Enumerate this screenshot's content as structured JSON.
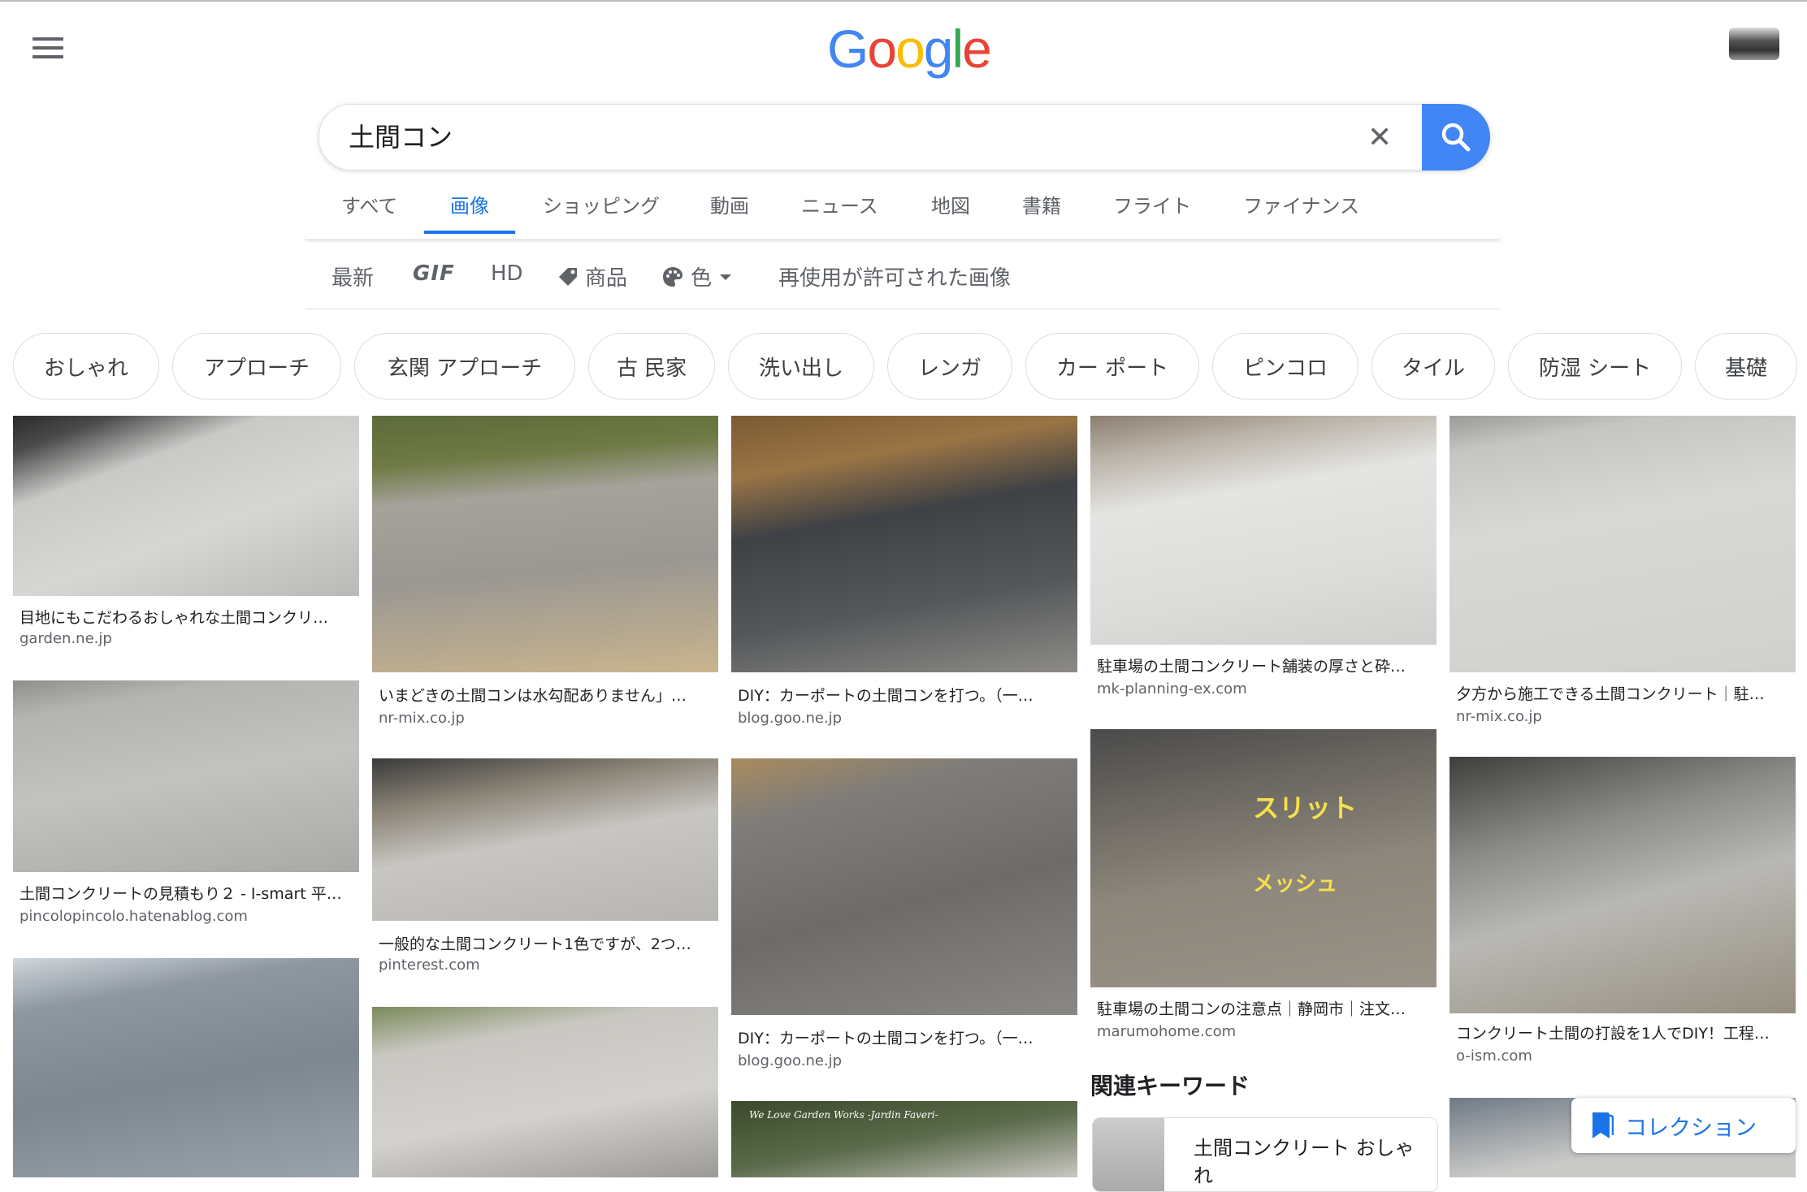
{
  "logo": [
    "G",
    "o",
    "o",
    "g",
    "l",
    "e"
  ],
  "search": {
    "value": "土間コン"
  },
  "tabs": [
    {
      "label": "すべて",
      "active": false
    },
    {
      "label": "画像",
      "active": true
    },
    {
      "label": "ショッピング",
      "active": false
    },
    {
      "label": "動画",
      "active": false
    },
    {
      "label": "ニュース",
      "active": false
    },
    {
      "label": "地図",
      "active": false
    },
    {
      "label": "書籍",
      "active": false
    },
    {
      "label": "フライト",
      "active": false
    },
    {
      "label": "ファイナンス",
      "active": false
    }
  ],
  "filters": {
    "latest": "最新",
    "gif": "GIF",
    "hd": "HD",
    "product": "商品",
    "color": "色",
    "reuse": "再使用が許可された画像"
  },
  "chips": [
    "おしゃれ",
    "アプローチ",
    "玄関 アプローチ",
    "古 民家",
    "洗い出し",
    "レンガ",
    "カー ポート",
    "ピンコロ",
    "タイル",
    "防湿 シート",
    "基礎"
  ],
  "results": [
    {
      "title": "目地にもこだわるおしゃれな土間コンクリ…",
      "site": "garden.ne.jp"
    },
    {
      "title": "土間コンクリートの見積もり２ - I-smart 平…",
      "site": "pincolopincolo.hatenablog.com"
    },
    {
      "title": "",
      "site": ""
    },
    {
      "title": "いまどきの土間コンは水勾配ありません」…",
      "site": "nr-mix.co.jp"
    },
    {
      "title": "一般的な土間コンクリート1色ですが、2つ…",
      "site": "pinterest.com"
    },
    {
      "title": "",
      "site": ""
    },
    {
      "title": "DIY：カーポートの土間コンを打つ。（一…",
      "site": "blog.goo.ne.jp"
    },
    {
      "title": "DIY：カーポートの土間コンを打つ。（一…",
      "site": "blog.goo.ne.jp"
    },
    {
      "title": "",
      "site": "",
      "overlay": "We Love Garden Works -Jardin Faveri-"
    },
    {
      "title": "駐車場の土間コンクリート舗装の厚さと砕…",
      "site": "mk-planning-ex.com"
    },
    {
      "title": "駐車場の土間コンの注意点｜静岡市｜注文…",
      "site": "marumohome.com",
      "overlay1": "スリット",
      "overlay2": "メッシュ"
    },
    {
      "title": "夕方から施工できる土間コンクリート｜駐…",
      "site": "nr-mix.co.jp"
    },
    {
      "title": "コンクリート土間の打設を1人でDIY！工程…",
      "site": "o-ism.com"
    },
    {
      "title": "",
      "site": ""
    }
  ],
  "related": {
    "heading": "関連キーワード",
    "item": "土間コンクリート おしゃれ"
  },
  "collection": {
    "label": "コレクション"
  }
}
